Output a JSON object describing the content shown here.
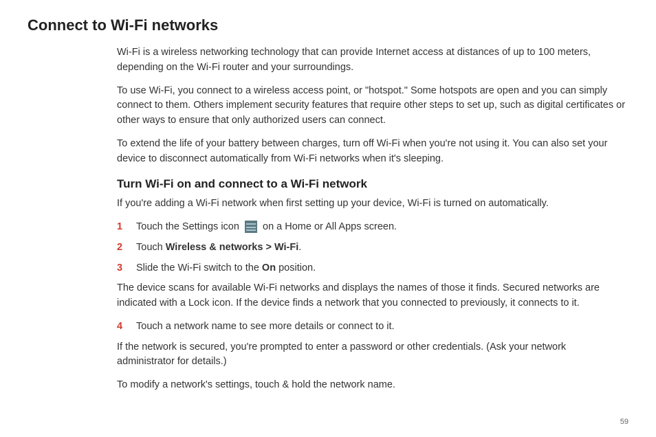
{
  "page_title": "Connect to Wi-Fi networks",
  "intro_paragraphs": [
    "Wi-Fi is a wireless networking technology that can provide Internet access at distances of up to 100 meters, depending on the Wi-Fi router and your surroundings.",
    "To use Wi-Fi, you connect to a wireless access point, or \"hotspot.\" Some hotspots are open and you can simply connect to them. Others implement security features that require other steps to set up, such as digital certificates or other ways to ensure that only authorized users can connect.",
    "To extend the life of your battery between charges, turn off Wi-Fi when you're not using it. You can also set your device to disconnect automatically from Wi-Fi networks when it's sleeping."
  ],
  "section_title": "Turn Wi-Fi on and connect to a Wi-Fi network",
  "section_intro": "If you're adding a Wi-Fi network when first setting up your device, Wi-Fi is turned on automatically.",
  "step1": {
    "num": "1",
    "pre": "Touch the Settings icon ",
    "post": " on a Home or All Apps screen."
  },
  "step2": {
    "num": "2",
    "pre": "Touch ",
    "bold": "Wireless & networks > Wi-Fi",
    "post": "."
  },
  "step3": {
    "num": "3",
    "pre": "Slide the Wi-Fi switch to the ",
    "bold": "On",
    "post": " position."
  },
  "after_step3": "The device scans for available Wi-Fi networks and displays the names of those it finds. Secured networks are indicated with a Lock icon. If the device finds a network that you connected to previously, it connects to it.",
  "step4": {
    "num": "4",
    "text": "Touch a network name to see more details or connect to it."
  },
  "after_step4_1": "If the network is secured, you're prompted to enter a password or other credentials. (Ask your network administrator for details.)",
  "after_step4_2": "To modify a network's settings, touch & hold the network name.",
  "page_number": "59"
}
